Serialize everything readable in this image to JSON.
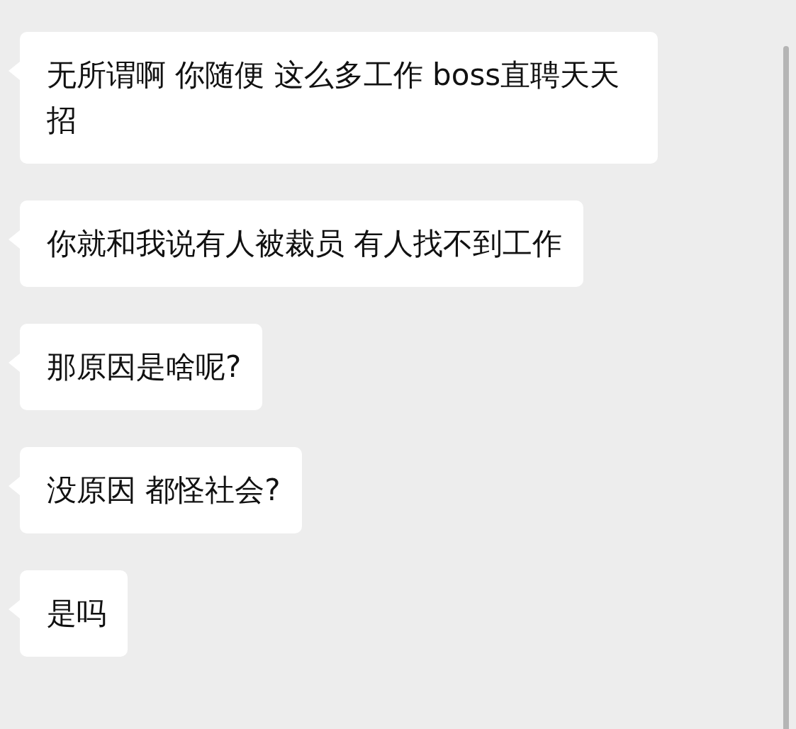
{
  "messages": [
    {
      "text": "无所谓啊 你随便 这么多工作 boss直聘天天招"
    },
    {
      "text": "你就和我说有人被裁员 有人找不到工作"
    },
    {
      "text": "那原因是啥呢?"
    },
    {
      "text": "没原因 都怪社会?"
    },
    {
      "text": "是吗"
    }
  ]
}
